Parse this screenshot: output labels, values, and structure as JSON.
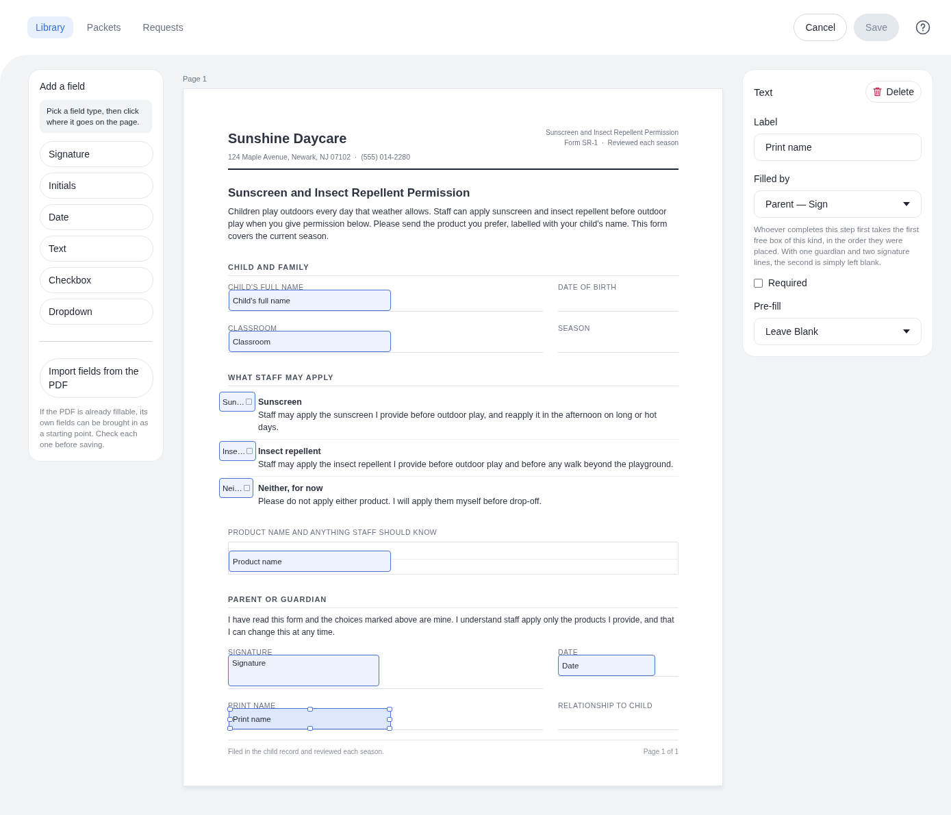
{
  "tabs": [
    {
      "label": "Library",
      "selected": true
    },
    {
      "label": "Packets",
      "selected": false
    },
    {
      "label": "Requests",
      "selected": false
    }
  ],
  "actions": {
    "cancel": "Cancel",
    "save": "Save",
    "save_disabled": true
  },
  "add_panel": {
    "title": "Add a field",
    "hint": "Pick a field type, then click where it goes on the page.",
    "field_types": [
      "Signature",
      "Initials",
      "Date",
      "Text",
      "Checkbox",
      "Dropdown"
    ],
    "import_button": "Import fields from the PDF",
    "import_note": "If the PDF is already fillable, its own fields can be brought in as a starting point. Check each one before saving."
  },
  "page_label": "Page 1",
  "document": {
    "org": "Sunshine Daycare",
    "address": "124 Maple Avenue, Newark, NJ 07102  ·  (555) 014-2280",
    "meta": [
      "Sunscreen and Insect Repellent Permission",
      "Form SR-1  ·  Reviewed each season"
    ],
    "title": "Sunscreen and Insect Repellent Permission",
    "intro": "Children play outdoors every day that weather allows. Staff can apply sunscreen and insect repellent before outdoor play when you give permission below. Please send the product you prefer, labelled with your child's name. This form covers the current season.",
    "sections": [
      {
        "heading": "CHILD AND FAMILY",
        "items": [
          {
            "kind": "field_row",
            "fields": [
              {
                "label": "CHILD'S FULL NAME",
                "placed": {
                  "kind": "text",
                  "text": "Child's full name",
                  "selected": false
                }
              },
              {
                "label": "DATE OF BIRTH"
              }
            ]
          },
          {
            "kind": "field_row",
            "fields": [
              {
                "label": "CLASSROOM",
                "placed": {
                  "kind": "text",
                  "text": "Classroom",
                  "selected": false
                }
              },
              {
                "label": "SEASON"
              }
            ]
          }
        ]
      },
      {
        "heading": "WHAT STAFF MAY APPLY",
        "items": [
          {
            "kind": "choice",
            "title": "Sunscreen",
            "text": "Staff may apply the sunscreen I provide before outdoor play, and reapply it in the afternoon on long or hot days.",
            "placed": {
              "kind": "checkbox",
              "text": "Sun…",
              "selected": false
            }
          },
          {
            "kind": "choice",
            "title": "Insect repellent",
            "text": "Staff may apply the insect repellent I provide before outdoor play and before any walk beyond the playground.",
            "placed": {
              "kind": "checkbox",
              "text": "Inse…",
              "selected": false
            }
          },
          {
            "kind": "choice",
            "title": "Neither, for now",
            "text": "Please do not apply either product. I will apply them myself before drop-off.",
            "placed": {
              "kind": "checkbox",
              "text": "Nei…",
              "selected": false
            }
          }
        ]
      },
      {
        "items": [
          {
            "kind": "textarea",
            "label": "PRODUCT NAME AND ANYTHING STAFF SHOULD KNOW",
            "placed": {
              "kind": "text",
              "text": "Product name",
              "selected": false
            }
          }
        ]
      },
      {
        "heading": "PARENT OR GUARDIAN",
        "paragraph": "I have read this form and the choices marked above are mine. I understand staff apply only the products I provide, and that I can change this at any time.",
        "items": [
          {
            "kind": "field_row",
            "fields": [
              {
                "label": "SIGNATURE",
                "placed": {
                  "kind": "signature",
                  "text": "Signature",
                  "selected": false
                }
              },
              {
                "label": "DATE",
                "placed": {
                  "kind": "date",
                  "text": "Date",
                  "selected": false
                }
              }
            ]
          },
          {
            "kind": "field_row",
            "fields": [
              {
                "label": "PRINT NAME",
                "placed": {
                  "kind": "text",
                  "text": "Print name",
                  "selected": true
                }
              },
              {
                "label": "RELATIONSHIP TO CHILD"
              }
            ]
          }
        ]
      }
    ],
    "footer_note": "Filed in the child record and reviewed each season.",
    "page_number": "Page 1 of 1"
  },
  "props": {
    "type_title": "Text",
    "delete": "Delete",
    "label_caption": "Label",
    "label_value": "Print name",
    "filled_by_caption": "Filled by",
    "filled_by_value": "Parent — Sign",
    "filled_by_note": "Whoever completes this step first takes the first free box of this kind, in the order they were placed. With one guardian and two signature lines, the second is simply left blank.",
    "required": {
      "label": "Required",
      "checked": false
    },
    "prefill_caption": "Pre-fill",
    "prefill_value": "Leave Blank"
  }
}
